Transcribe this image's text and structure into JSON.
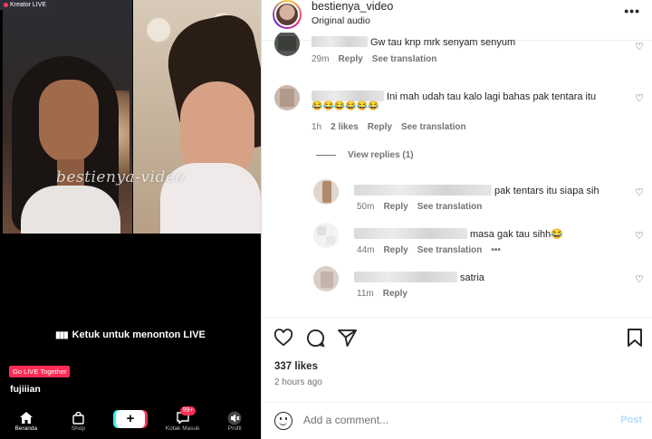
{
  "media": {
    "badge": "Kreator LIVE",
    "watermark": "bestienya-video",
    "tap_to_watch": "Ketuk untuk menonton LIVE",
    "go_live": "Go LIVE Together",
    "username": "fujiiian",
    "tabs": [
      {
        "label": "Beranda",
        "icon": "home-icon"
      },
      {
        "label": "Shop",
        "icon": "shop-bag-icon"
      },
      {
        "label": "",
        "icon": "plus-icon"
      },
      {
        "label": "Kotak Masuk",
        "icon": "inbox-icon",
        "badge": "99+"
      },
      {
        "label": "Profil",
        "icon": "mute-icon"
      }
    ]
  },
  "post": {
    "account": "bestienya_video",
    "audio": "Original audio",
    "likes": "337 likes",
    "time_ago": "2 hours ago",
    "add_comment_placeholder": "Add a comment...",
    "post_label": "Post"
  },
  "comments": [
    {
      "text": "Gw tau knp mrk senyam senyum",
      "time": "29m",
      "likes": "",
      "reply": "Reply",
      "translate": "See translation"
    },
    {
      "text": "Ini mah udah tau kalo lagi bahas pak tentara itu",
      "emoji": "😂😂😂😂😂😂",
      "time": "1h",
      "likes": "2 likes",
      "reply": "Reply",
      "translate": "See translation"
    }
  ],
  "view_replies": "View replies (1)",
  "replies": [
    {
      "text": "pak tentars itu siapa sih",
      "time": "50m",
      "reply": "Reply",
      "translate": "See translation",
      "more": ""
    },
    {
      "text": "masa gak tau sihh😂",
      "time": "44m",
      "reply": "Reply",
      "translate": "See translation",
      "more": "•••"
    },
    {
      "text": "satria",
      "time": "11m",
      "reply": "Reply",
      "translate": "",
      "more": ""
    }
  ],
  "colors": {
    "accent": "#0095f6",
    "post_disabled": "#b3dbff",
    "live_red": "#fe2c55"
  }
}
